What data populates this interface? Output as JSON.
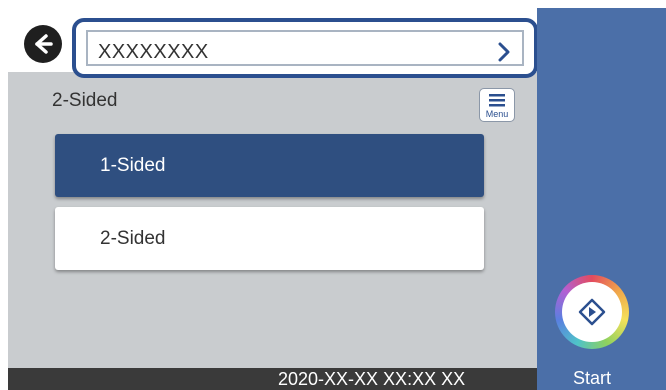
{
  "header": {
    "path_value": "XXXXXXXX"
  },
  "setting": {
    "title": "2-Sided",
    "menu_label": "Menu"
  },
  "options": [
    {
      "label": "1-Sided",
      "selected": true
    },
    {
      "label": "2-Sided",
      "selected": false
    }
  ],
  "status_bar": {
    "datetime": "2020-XX-XX XX:XX XX"
  },
  "side_panel": {
    "start_label": "Start"
  },
  "colors": {
    "accent_blue": "#2f4f80",
    "side_panel": "#4b6fa8",
    "background": "#c9cccf"
  },
  "icons": [
    "back-arrow-icon",
    "chevron-right-icon",
    "menu-icon",
    "start-icon"
  ]
}
